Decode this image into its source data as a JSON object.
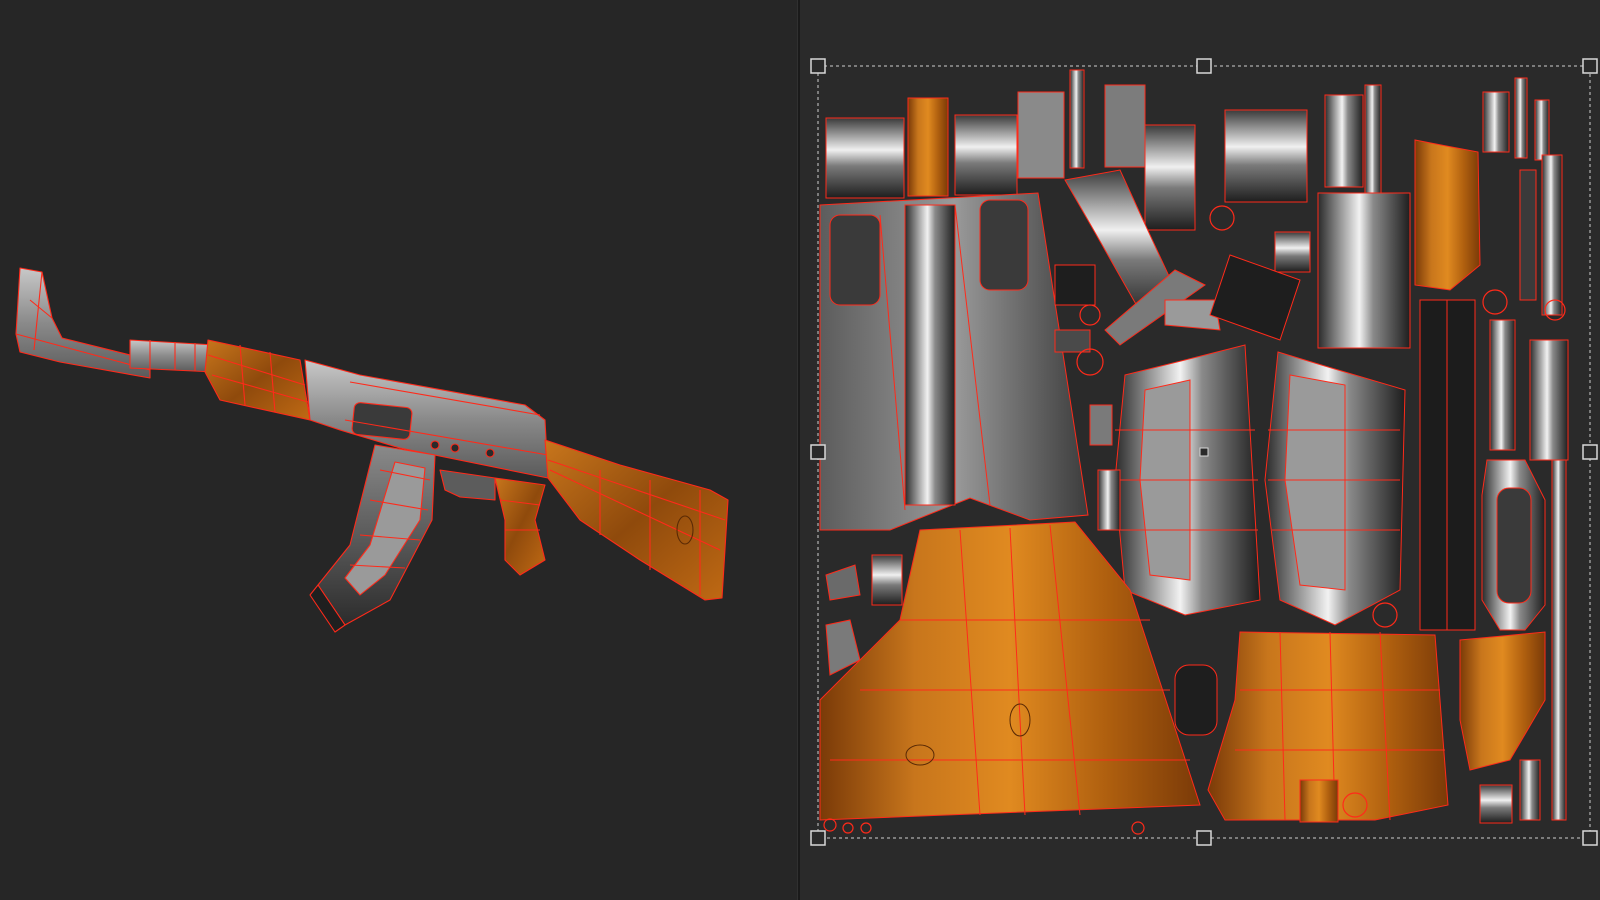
{
  "viewport_3d": {
    "model": "rifle-model",
    "wireframe_overlay": true
  },
  "uv_editor": {
    "selection": {
      "frame_style": "dashed",
      "handles": 8
    }
  },
  "colors": {
    "background": "#262626",
    "uv_background": "#2a2a2a",
    "wireframe": "#ff2a1a",
    "metal_light": "#9a9a9a",
    "metal_dark": "#2e2e2e",
    "wood_light": "#c8761c",
    "wood_dark": "#6b3206",
    "selection_frame": "#cfcfcf"
  }
}
